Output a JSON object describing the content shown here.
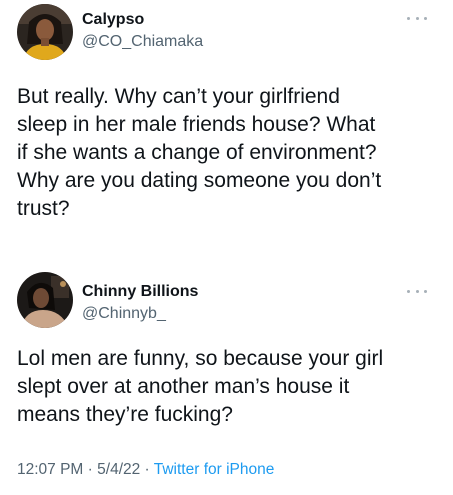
{
  "tweets": [
    {
      "author": {
        "name": "Calypso",
        "handle": "@CO_Chiamaka",
        "avatar_icon": "profile-photo-avatar"
      },
      "more_icon": "more-options-icon",
      "text": "But really. Why can’t your girlfriend\nsleep in her male friends house? What\nif she wants a change of environment?\nWhy are you dating someone you don’t\ntrust?"
    },
    {
      "author": {
        "name": "Chinny Billions",
        "handle": "@Chinnyb_",
        "avatar_icon": "profile-photo-avatar"
      },
      "more_icon": "more-options-icon",
      "text": "Lol men are funny, so because your girl\nslept over at another man’s house it\nmeans they’re fucking?",
      "meta": {
        "time": "12:07 PM",
        "separator": " · ",
        "date": "5/4/22",
        "source": "Twitter for iPhone"
      }
    }
  ],
  "colors": {
    "text_primary": "#0f1419",
    "text_secondary": "#536471",
    "link": "#1d9bf0"
  }
}
